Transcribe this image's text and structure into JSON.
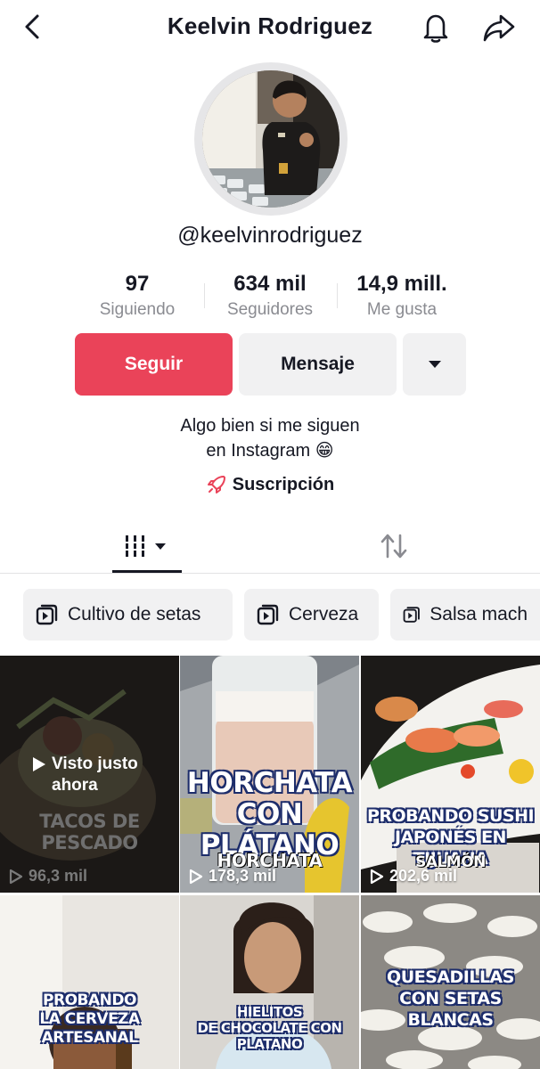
{
  "header": {
    "title": "Keelvin Rodriguez"
  },
  "profile": {
    "username": "@keelvinrodriguez"
  },
  "stats": [
    {
      "value": "97",
      "label": "Siguiendo"
    },
    {
      "value": "634 mil",
      "label": "Seguidores"
    },
    {
      "value": "14,9 mill.",
      "label": "Me gusta"
    }
  ],
  "actions": {
    "follow": "Seguir",
    "message": "Mensaje"
  },
  "bio": {
    "line1": "Algo bien si me siguen",
    "line2": "en Instagram 😁"
  },
  "subscription": {
    "label": "Suscripción"
  },
  "playlists": [
    "Cultivo de setas",
    "Cerveza",
    "Salsa mach"
  ],
  "videos": [
    {
      "title": "TACOS DE PESCADO",
      "overlay": "Visto justo\nahora",
      "views": "96,3 mil"
    },
    {
      "title": "HORCHATA\nCON PLÁTANO",
      "caption": "HORCHATA",
      "views": "178,3 mil"
    },
    {
      "title": "PROBANDO SUSHI\nJAPONÉS EN TIJUANA",
      "caption": "SALMÓN",
      "views": "202,6 mil"
    },
    {
      "title": "PROBANDO\nLA CERVEZA ARTESANAL"
    },
    {
      "title": "HIELITOS\nDE CHOCOLATE CON PLATANO"
    },
    {
      "title": "QUESADILLAS\nCON SETAS BLANCAS"
    }
  ],
  "colors": {
    "accent": "#ea4359",
    "text": "#161823",
    "muted": "#8a8b91",
    "surface": "#f1f1f2"
  }
}
